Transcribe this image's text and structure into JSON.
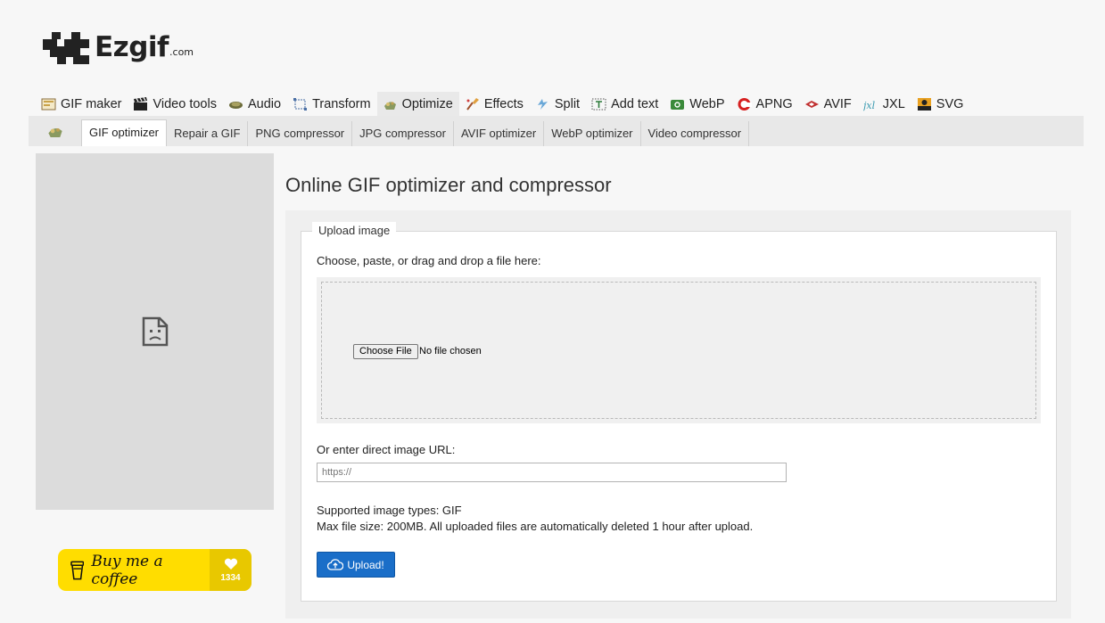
{
  "logo": {
    "name": "Ezgif",
    "tld": ".com"
  },
  "main_nav": [
    {
      "label": "GIF maker",
      "icon": "gif-maker-icon"
    },
    {
      "label": "Video tools",
      "icon": "clapperboard-icon"
    },
    {
      "label": "Audio",
      "icon": "audio-icon"
    },
    {
      "label": "Transform",
      "icon": "transform-icon"
    },
    {
      "label": "Optimize",
      "icon": "optimize-icon",
      "active": true
    },
    {
      "label": "Effects",
      "icon": "effects-brush-icon"
    },
    {
      "label": "Split",
      "icon": "split-icon"
    },
    {
      "label": "Add text",
      "icon": "add-text-icon"
    },
    {
      "label": "WebP",
      "icon": "webp-icon"
    },
    {
      "label": "APNG",
      "icon": "apng-icon"
    },
    {
      "label": "AVIF",
      "icon": "avif-icon"
    },
    {
      "label": "JXL",
      "icon": "jxl-icon"
    },
    {
      "label": "SVG",
      "icon": "svg-icon"
    }
  ],
  "sub_nav": [
    {
      "label": "GIF optimizer",
      "active": true
    },
    {
      "label": "Repair a GIF"
    },
    {
      "label": "PNG compressor"
    },
    {
      "label": "JPG compressor"
    },
    {
      "label": "AVIF optimizer"
    },
    {
      "label": "WebP optimizer"
    },
    {
      "label": "Video compressor"
    }
  ],
  "page": {
    "title": "Online GIF optimizer and compressor"
  },
  "upload_form": {
    "legend": "Upload image",
    "choose_label": "Choose, paste, or drag and drop a file here:",
    "file_button": "Choose File",
    "file_status": "No file chosen",
    "url_label": "Or enter direct image URL:",
    "url_placeholder": "https://",
    "url_value": "",
    "supported_types": "Supported image types: GIF",
    "max_size": "Max file size: 200MB. All uploaded files are automatically deleted 1 hour after upload.",
    "upload_button": "Upload!"
  },
  "sidebar": {
    "coffee_label": "Buy me a coffee",
    "coffee_count": "1334"
  },
  "colors": {
    "accent": "#1a6ec8",
    "coffee_yellow": "#ffdd00",
    "background": "#f7f7f7"
  }
}
